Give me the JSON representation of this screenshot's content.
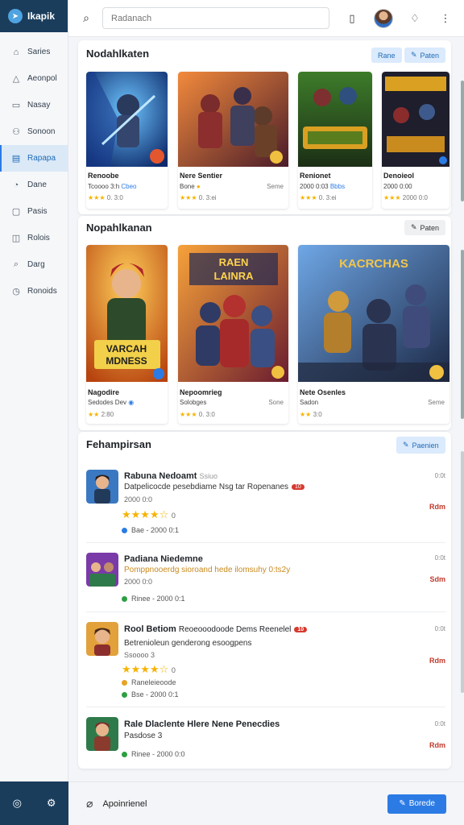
{
  "app": {
    "brand": "Ikapik"
  },
  "sidebar": {
    "items": [
      {
        "label": "Saries",
        "icon": "home-icon",
        "active": false
      },
      {
        "label": "Aeonpol",
        "icon": "bell-icon",
        "active": false
      },
      {
        "label": "Nasay",
        "icon": "box-icon",
        "active": false
      },
      {
        "label": "Sonoon",
        "icon": "people-icon",
        "active": false
      },
      {
        "label": "Rapapa",
        "icon": "library-icon",
        "active": true
      },
      {
        "label": "Dane",
        "icon": "search-icon",
        "active": false
      },
      {
        "label": "Pasis",
        "icon": "folder-icon",
        "active": false
      },
      {
        "label": "Rolois",
        "icon": "shield-icon",
        "active": false
      },
      {
        "label": "Darg",
        "icon": "magnifier-icon",
        "active": false
      },
      {
        "label": "Ronoids",
        "icon": "clock-icon",
        "active": false
      }
    ],
    "footer": {
      "left_icon": "globe-icon",
      "right_icon": "settings-icon"
    }
  },
  "topbar": {
    "search_placeholder": "Radanach"
  },
  "section1": {
    "title": "Nodahlkaten",
    "chip1": "Rane",
    "chip2": "Paten",
    "cards": [
      {
        "title": "Renoobe",
        "sub": "Tcoooo 3:h",
        "sub_tag": "Cbeo",
        "rating": "0. 3:0",
        "theme": "blue"
      },
      {
        "title": "Nere Sentier",
        "sub": "Bone",
        "sub_right": "Seme",
        "rating": "0. 3:ei",
        "theme": "red"
      },
      {
        "title": "Renionet",
        "sub": "2000 0:03",
        "sub_tag": "Bbbs",
        "rating": "0. 3:ei",
        "theme": "green"
      },
      {
        "title": "Denoieol",
        "sub": "2000 0:00",
        "sub_tag": "",
        "rating": "2000 0:0",
        "theme": "gold"
      }
    ]
  },
  "section2": {
    "title": "Nopahlkanan",
    "chip": "Paten",
    "cards": [
      {
        "title": "Nagodire",
        "sub": "Sedodes Dev",
        "rating": "2:80",
        "art_text": "VARCAH MDNESS",
        "theme": "orange"
      },
      {
        "title": "Nepoomrieg",
        "sub": "Solobges",
        "sub_right": "Sone",
        "rating": "0. 3:0",
        "art_text": "RAEN LAINRA",
        "theme": "redcomic"
      },
      {
        "title": "Nete Osenles",
        "sub": "Sadon",
        "sub_right": "Seme",
        "rating": "3:0",
        "art_text": "KACRCHAS",
        "theme": "blueaction"
      }
    ]
  },
  "section3": {
    "title": "Fehampirsan",
    "chip": "Paenien",
    "rows": [
      {
        "title": "Rabuna Nedoamt",
        "title_extra": "Ssiuo",
        "desc": "Datpelicocde pesebdiame Nsg tar Ropenanes",
        "badge": "10",
        "meta": "2000 0:0",
        "stars": "★★★★☆",
        "rating": "0",
        "foot": "Bae - 2000 0:1",
        "dot": "#2c7be5",
        "time": "0:0t",
        "action": "Rdm"
      },
      {
        "title": "Padiana Niedemne",
        "desc": "Pomppnooerdg sioroand hede ilomsuhy 0:ts2y",
        "meta": "2000 0:0",
        "foot": "Rinee - 2000 0:1",
        "dot": "#2e9e44",
        "time": "0:0t",
        "action": "Sdm"
      },
      {
        "title": "Rool Betiom",
        "title_extra": "Reoeooodoode Dems Reenelel",
        "desc": "Betrenioleun genderong esoogpens",
        "badge": "10",
        "meta": "Ssoooo 3",
        "stars": "★★★★☆",
        "rating": "0",
        "foot": "Bse - 2000 0:1",
        "foot_extra": "Raneleieoode",
        "dot": "#2e9e44",
        "time": "0:0t",
        "action": "Rdm"
      },
      {
        "title": "Rale Dlaclente Hlere Nene Penecdies",
        "desc": "Pasdose 3",
        "meta": "",
        "foot": "Rinee - 2000 0:0",
        "dot": "#2e9e44",
        "time": "0:0t",
        "action": "Rdm"
      }
    ]
  },
  "bottom": {
    "label": "Apoinrienel",
    "button": "Borede"
  }
}
